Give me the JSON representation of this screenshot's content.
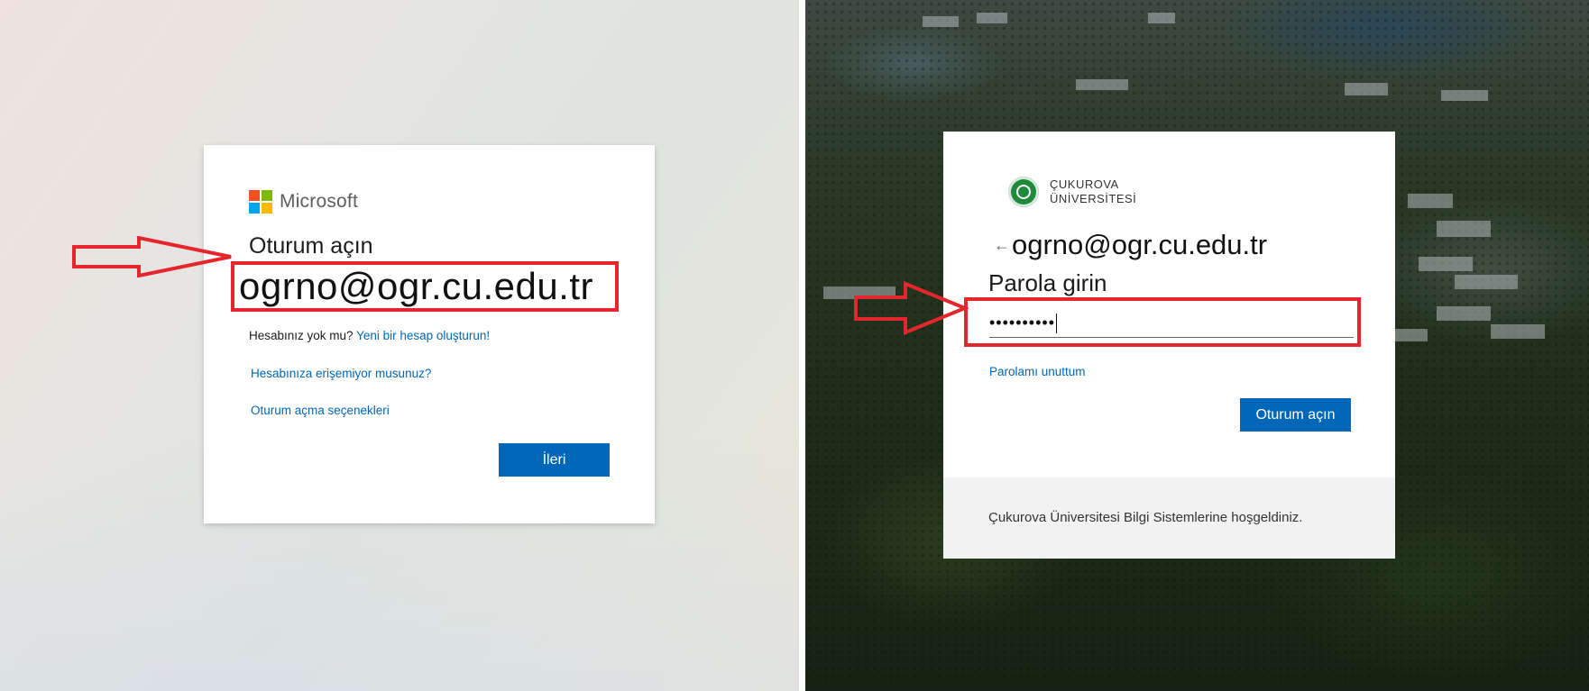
{
  "left": {
    "logo_text": "Microsoft",
    "title": "Oturum açın",
    "email_value": "ogrno@ogr.cu.edu.tr",
    "no_account_text": "Hesabınız yok mu?",
    "create_account_link": "Yeni bir hesap oluşturun!",
    "cant_access_link": "Hesabınıza erişemiyor musunuz?",
    "signin_options_link": "Oturum açma seçenekleri",
    "next_button": "İleri"
  },
  "right": {
    "logo_line1": "ÇUKUROVA",
    "logo_line2": "ÜNİVERSİTESİ",
    "back_arrow": "←",
    "email_value": "ogrno@ogr.cu.edu.tr",
    "title": "Parola girin",
    "password_mask": "••••••••••",
    "forgot_link": "Parolamı unuttum",
    "signin_button": "Oturum açın",
    "footer_text": "Çukurova Üniversitesi Bilgi Sistemlerine hoşgeldiniz."
  },
  "colors": {
    "accent": "#0067b8",
    "highlight": "#e5272d"
  }
}
